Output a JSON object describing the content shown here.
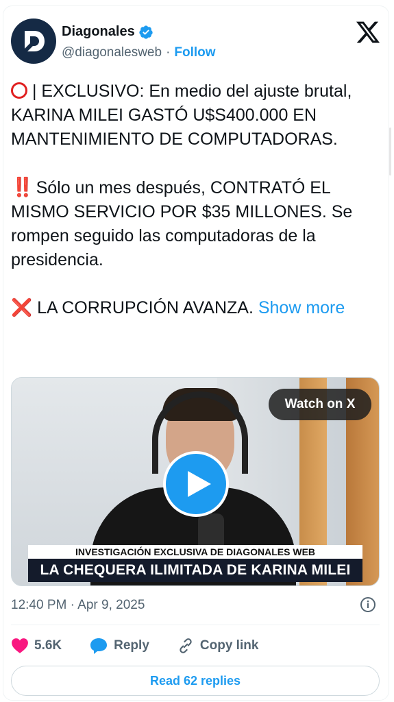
{
  "author": {
    "name": "Diagonales",
    "handle": "@diagonalesweb",
    "separator": "·",
    "follow_label": "Follow"
  },
  "icons": {
    "verified": "verified-badge-icon",
    "platform": "x-logo-icon",
    "play": "play-icon",
    "info": "info-icon",
    "like": "heart-icon",
    "reply": "reply-bubble-icon",
    "copy_link": "link-icon"
  },
  "tweet": {
    "line1_text": " | EXCLUSIVO: En medio del ajuste brutal, KARINA MILEI GASTÓ U$S400.000 EN MANTENIMIENTO DE COMPUTADORAS.",
    "line2_emoji": "‼️",
    "line2_text": " Sólo un mes después, CONTRATÓ EL MISMO SERVICIO POR $35 MILLONES. Se rompen seguido las computadoras de la presidencia.",
    "line3_emoji": "❌",
    "line3_text": " LA CORRUPCIÓN AVANZA. ",
    "show_more": "Show more"
  },
  "media": {
    "watch_label": "Watch on X",
    "caption_top": "INVESTIGACIÓN EXCLUSIVA DE DIAGONALES WEB",
    "caption_bottom": "LA CHEQUERA ILIMITADA DE KARINA MILEI"
  },
  "meta": {
    "timestamp": "12:40 PM · Apr 9, 2025"
  },
  "actions": {
    "likes": "5.6K",
    "reply_label": "Reply",
    "copy_label": "Copy link",
    "read_replies": "Read 62 replies"
  },
  "colors": {
    "accent": "#1d9bf0",
    "like": "#f91880",
    "emoji_red": "#e02020",
    "text": "#0f1419",
    "secondary": "#536471"
  }
}
